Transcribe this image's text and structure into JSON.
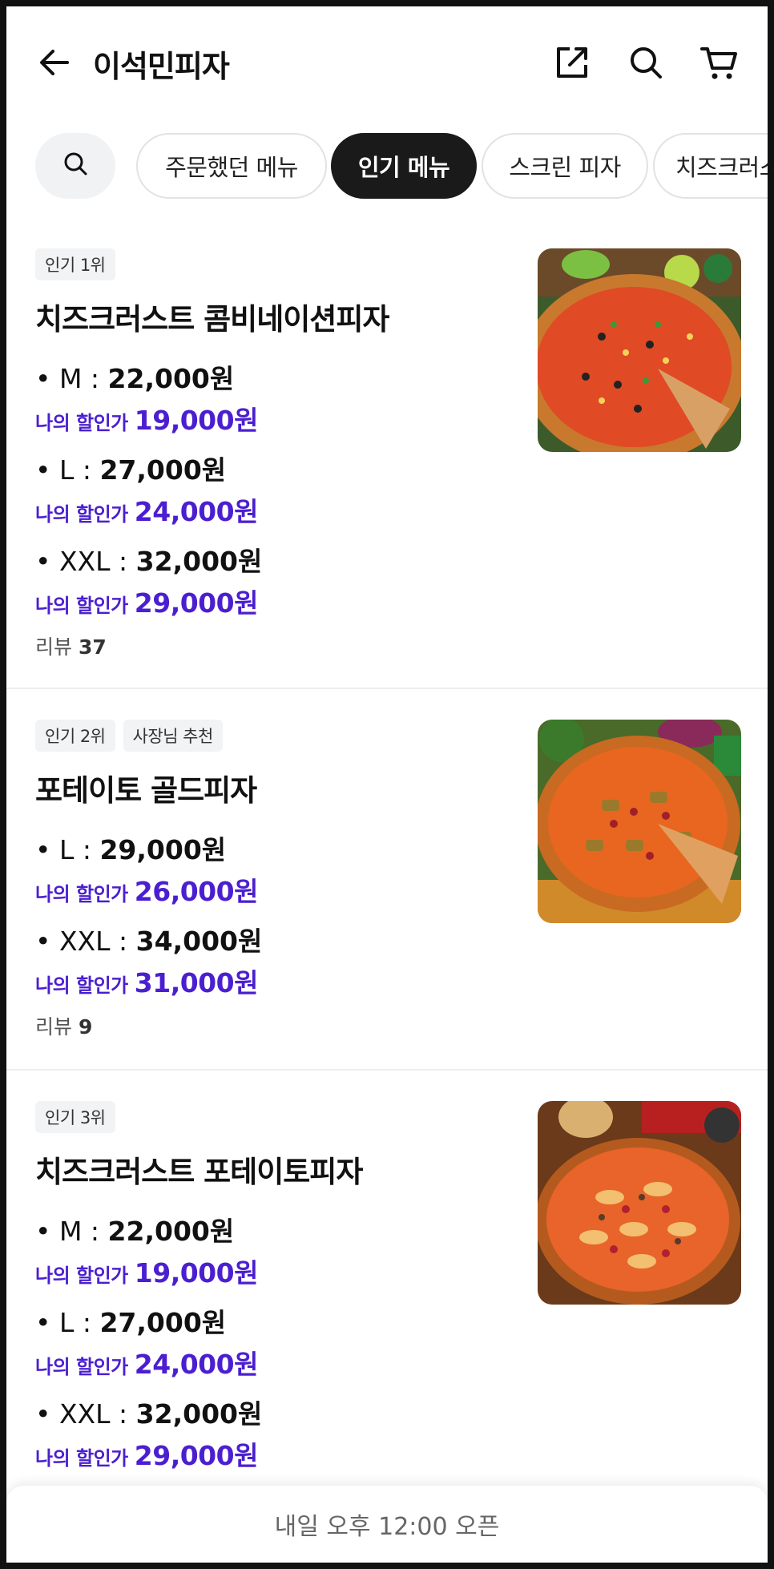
{
  "header": {
    "title": "이석민피자",
    "icons": [
      "back-arrow-icon",
      "share-icon",
      "search-icon",
      "cart-icon"
    ]
  },
  "chips": [
    {
      "label": "주문했던 메뉴",
      "selected": false
    },
    {
      "label": "인기 메뉴",
      "selected": true
    },
    {
      "label": "스크린 피자",
      "selected": false
    },
    {
      "label": "치즈크러스",
      "selected": false
    }
  ],
  "items": [
    {
      "badges": [
        "인기 1위"
      ],
      "name": "치즈크러스트 콤비네이션피자",
      "prices": [
        {
          "size": "• M : ",
          "price": "22,000원",
          "disc_label": "나의 할인가",
          "disc_price": "19,000원"
        },
        {
          "size": "• L : ",
          "price": "27,000원",
          "disc_label": "나의 할인가",
          "disc_price": "24,000원"
        },
        {
          "size": "• XXL : ",
          "price": "32,000원",
          "disc_label": "나의 할인가",
          "disc_price": "29,000원"
        }
      ],
      "review_label": "리뷰",
      "review_count": "37"
    },
    {
      "badges": [
        "인기 2위",
        "사장님 추천"
      ],
      "name": "포테이토 골드피자",
      "prices": [
        {
          "size": "• L : ",
          "price": "29,000원",
          "disc_label": "나의 할인가",
          "disc_price": "26,000원"
        },
        {
          "size": "• XXL : ",
          "price": "34,000원",
          "disc_label": "나의 할인가",
          "disc_price": "31,000원"
        }
      ],
      "review_label": "리뷰",
      "review_count": "9"
    },
    {
      "badges": [
        "인기 3위"
      ],
      "name": "치즈크러스트 포테이토피자",
      "prices": [
        {
          "size": "• M : ",
          "price": "22,000원",
          "disc_label": "나의 할인가",
          "disc_price": "19,000원"
        },
        {
          "size": "• L : ",
          "price": "27,000원",
          "disc_label": "나의 할인가",
          "disc_price": "24,000원"
        },
        {
          "size": "• XXL : ",
          "price": "32,000원",
          "disc_label": "나의 할인가",
          "disc_price": "29,000원"
        }
      ]
    }
  ],
  "bottom_bar": {
    "label": "내일 오후 12:00 오픈"
  },
  "colors": {
    "discount": "#4b1fd0",
    "selected_chip": "#1a1a1a"
  }
}
